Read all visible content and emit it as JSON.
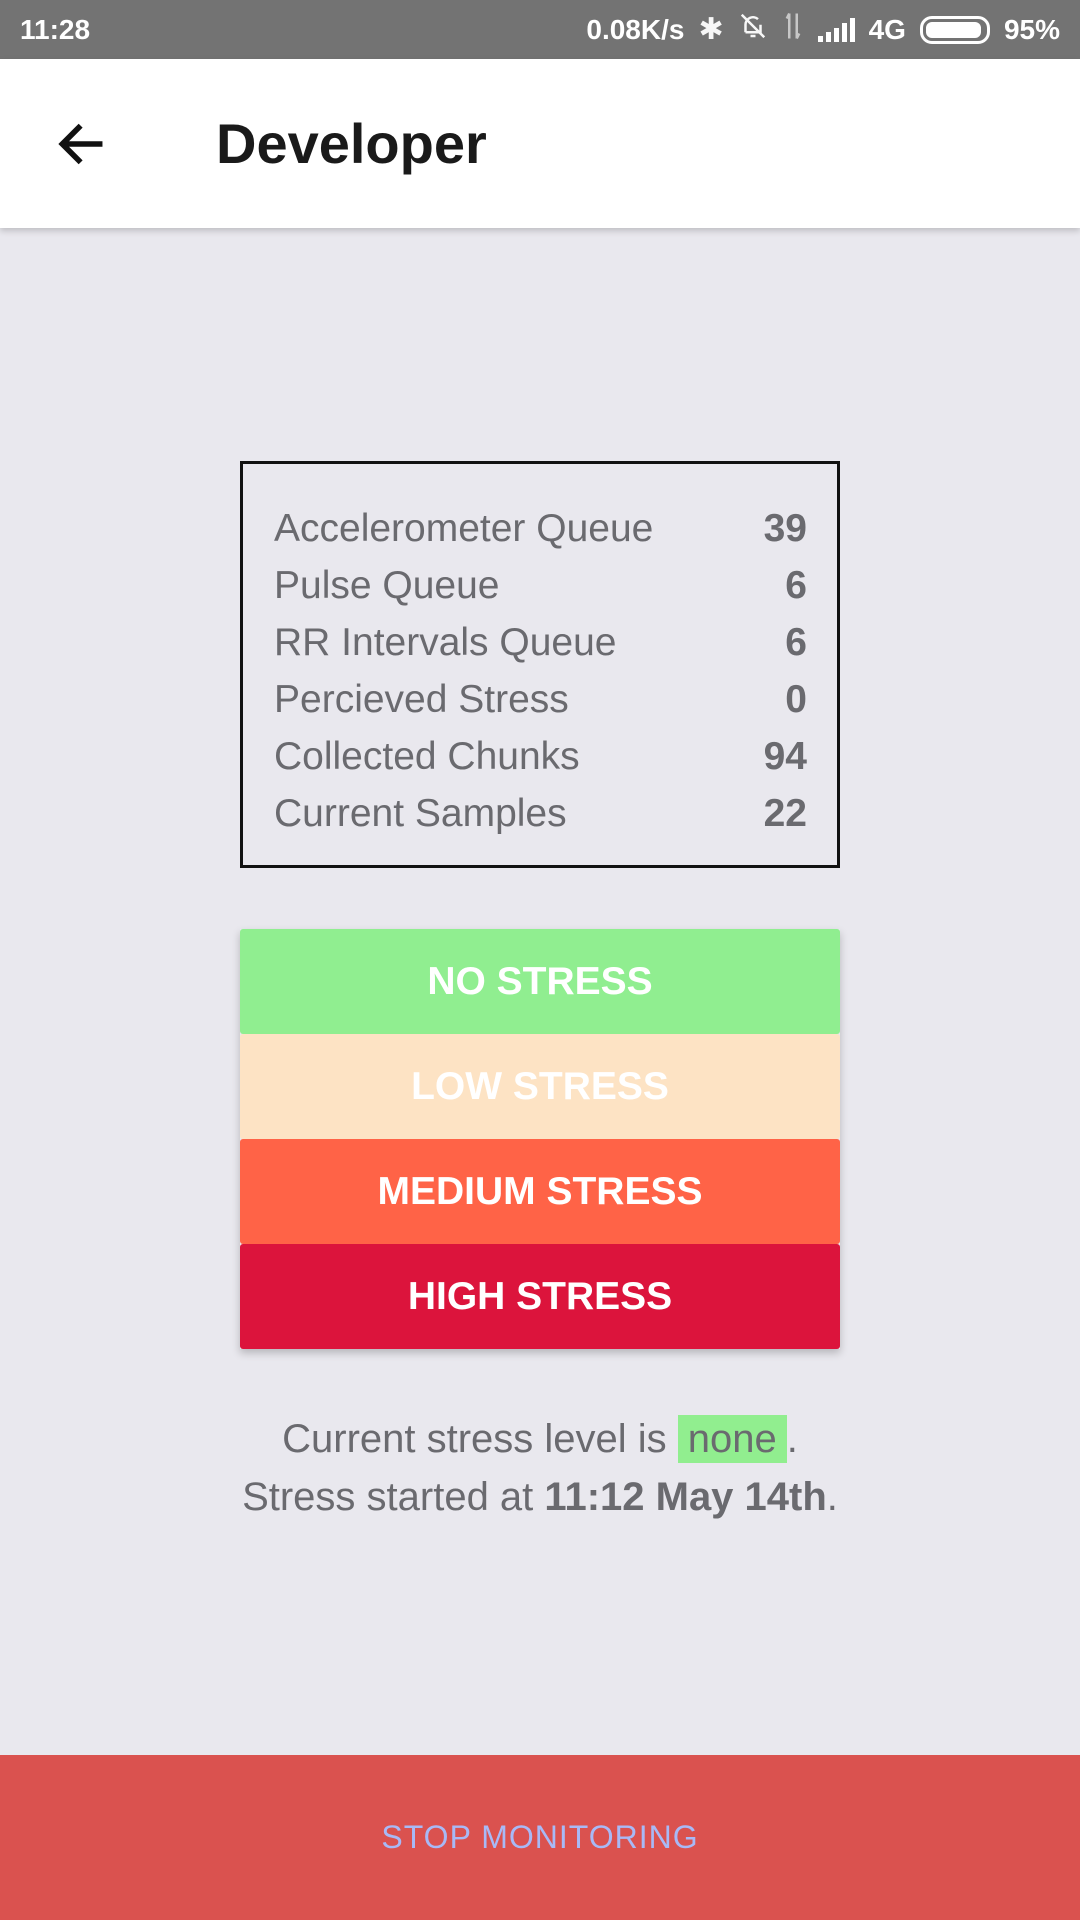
{
  "status_bar": {
    "time": "11:28",
    "net_speed": "0.08K/s",
    "bluetooth_icon": "bluetooth-icon",
    "mute_icon": "bell-off-icon",
    "data_icon": "data-arrows-icon",
    "signal_icon": "signal-icon",
    "network": "4G",
    "battery_level": 0.95,
    "battery_text": "95%"
  },
  "app_bar": {
    "back_icon": "arrow-back-icon",
    "title": "Developer"
  },
  "stats": [
    {
      "label": "Accelerometer Queue",
      "value": "39"
    },
    {
      "label": "Pulse Queue",
      "value": "6"
    },
    {
      "label": "RR Intervals Queue",
      "value": "6"
    },
    {
      "label": "Percieved Stress",
      "value": "0"
    },
    {
      "label": "Collected Chunks",
      "value": "94"
    },
    {
      "label": "Current Samples",
      "value": "22"
    }
  ],
  "stress_buttons": [
    {
      "label": "NO STRESS",
      "color": "#90ee90"
    },
    {
      "label": "LOW STRESS",
      "color": "#fde3c4"
    },
    {
      "label": "MEDIUM STRESS",
      "color": "#ff6347"
    },
    {
      "label": "HIGH STRESS",
      "color": "#dc143c"
    }
  ],
  "status_text": {
    "level_prefix": "Current stress level is ",
    "level": "none",
    "level_suffix": ".",
    "started_prefix": "Stress started at ",
    "started_at": "11:12 May 14th",
    "started_suffix": "."
  },
  "footer": {
    "stop_label": "STOP MONITORING",
    "stop_color": "#da524f"
  }
}
